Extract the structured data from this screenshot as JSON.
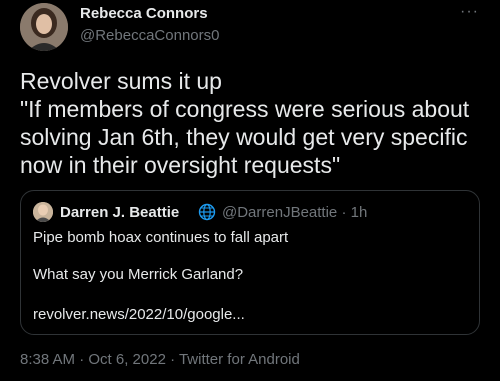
{
  "author": {
    "name": "Rebecca Connors",
    "handle": "@RebeccaConnors0"
  },
  "more_icon": "more-horizontal-icon",
  "tweet": {
    "lines": [
      "Revolver sums it up",
      "\"If members of congress were serious about",
      "solving Jan 6th, they would get very specific",
      "now in their oversight requests\""
    ]
  },
  "quoted": {
    "name": "Darren J. Beattie",
    "badge_icon": "globe-icon",
    "handle": "@DarrenJBeattie · 1h",
    "lines": [
      "Pipe bomb hoax continues to fall apart",
      "What say you Merrick Garland?",
      "revolver.news/2022/10/google..."
    ]
  },
  "meta": "8:38 AM · Oct 6, 2022 · Twitter for Android",
  "colors": {
    "background": "#000000",
    "text": "#e7e9ea",
    "secondary": "#71767b",
    "border": "#2f3336"
  }
}
